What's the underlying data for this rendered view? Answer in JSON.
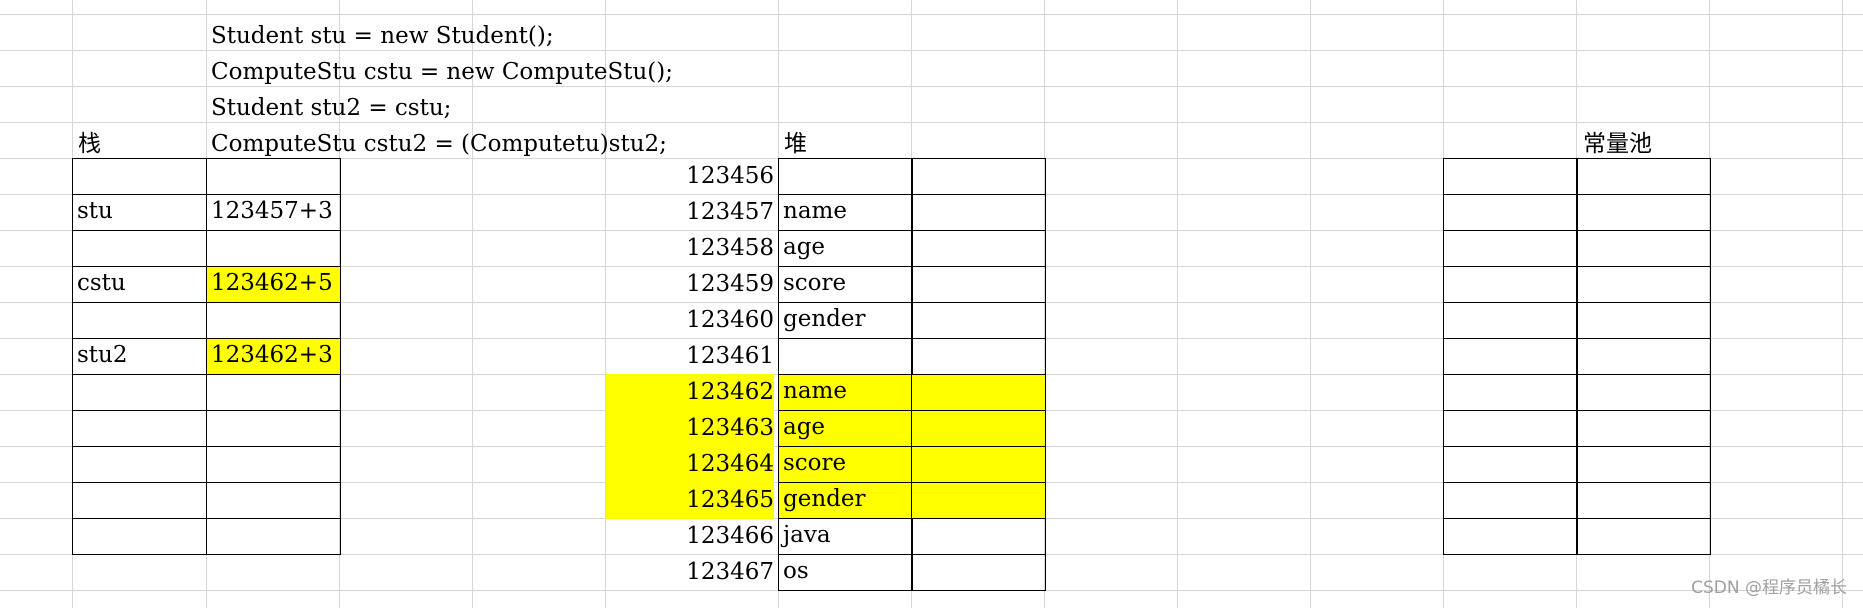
{
  "colors": {
    "highlight": "#ffff00",
    "gridline": "#d6d6d6",
    "border": "#000000",
    "watermark": "#a0a0a0"
  },
  "code_lines": [
    "Student stu = new Student();",
    "ComputeStu cstu = new ComputeStu();",
    "Student stu2 = cstu;",
    "ComputeStu cstu2 = (Computetu)stu2;"
  ],
  "stack": {
    "title": "栈",
    "rows": [
      {
        "name": "",
        "value": "",
        "highlight": false
      },
      {
        "name": "stu",
        "value": "123457+3",
        "highlight": false
      },
      {
        "name": "",
        "value": "",
        "highlight": false
      },
      {
        "name": "cstu",
        "value": "123462+5",
        "highlight": true
      },
      {
        "name": "",
        "value": "",
        "highlight": false
      },
      {
        "name": "stu2",
        "value": "123462+3",
        "highlight": true
      },
      {
        "name": "",
        "value": "",
        "highlight": false
      },
      {
        "name": "",
        "value": "",
        "highlight": false
      },
      {
        "name": "",
        "value": "",
        "highlight": false
      },
      {
        "name": "",
        "value": "",
        "highlight": false
      },
      {
        "name": "",
        "value": "",
        "highlight": false
      }
    ]
  },
  "heap": {
    "title": "堆",
    "rows": [
      {
        "address": "123456",
        "field": "",
        "highlight": false
      },
      {
        "address": "123457",
        "field": "name",
        "highlight": false
      },
      {
        "address": "123458",
        "field": "age",
        "highlight": false
      },
      {
        "address": "123459",
        "field": "score",
        "highlight": false
      },
      {
        "address": "123460",
        "field": "gender",
        "highlight": false
      },
      {
        "address": "123461",
        "field": "",
        "highlight": false
      },
      {
        "address": "123462",
        "field": "name",
        "highlight": true
      },
      {
        "address": "123463",
        "field": "age",
        "highlight": true
      },
      {
        "address": "123464",
        "field": "score",
        "highlight": true
      },
      {
        "address": "123465",
        "field": "gender",
        "highlight": true
      },
      {
        "address": "123466",
        "field": "java",
        "highlight": false
      },
      {
        "address": "123467",
        "field": "os",
        "highlight": false
      }
    ]
  },
  "constant_pool": {
    "title": "常量池",
    "row_count": 11
  },
  "watermark": "CSDN @程序员橘长"
}
